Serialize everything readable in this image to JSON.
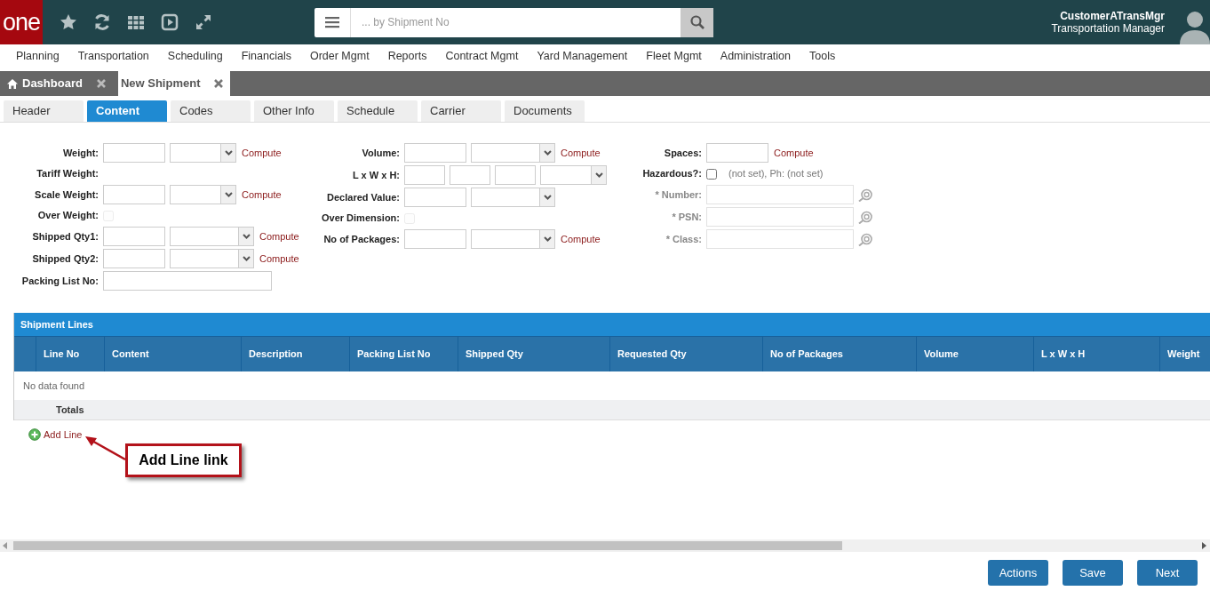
{
  "header": {
    "logo": "one",
    "search": {
      "placeholder": "... by Shipment No"
    },
    "user": {
      "name": "CustomerATransMgr",
      "role": "Transportation Manager"
    }
  },
  "menu": [
    "Planning",
    "Transportation",
    "Scheduling",
    "Financials",
    "Order Mgmt",
    "Reports",
    "Contract Mgmt",
    "Yard Management",
    "Fleet Mgmt",
    "Administration",
    "Tools"
  ],
  "page_tabs": [
    {
      "label": "Dashboard",
      "kind": "home",
      "selected": false
    },
    {
      "label": "New Shipment",
      "kind": "plain",
      "selected": true
    }
  ],
  "tabs": [
    {
      "label": "Header",
      "selected": false
    },
    {
      "label": "Content",
      "selected": true
    },
    {
      "label": "Codes",
      "selected": false
    },
    {
      "label": "Other Info",
      "selected": false
    },
    {
      "label": "Schedule",
      "selected": false
    },
    {
      "label": "Carrier",
      "selected": false
    },
    {
      "label": "Documents",
      "selected": false
    }
  ],
  "form": {
    "columns": [
      [
        {
          "kind": "measure",
          "label": "Weight:",
          "compute": "Compute"
        },
        {
          "kind": "text",
          "label": "Tariff Weight:"
        },
        {
          "kind": "measure",
          "label": "Scale Weight:",
          "compute": "Compute"
        },
        {
          "kind": "checkbox",
          "label": "Over Weight:",
          "checked": false,
          "disabled": true
        },
        {
          "kind": "quantity",
          "label": "Shipped Qty1:",
          "compute": "Compute"
        },
        {
          "kind": "quantity",
          "label": "Shipped Qty2:",
          "compute": "Compute"
        },
        {
          "kind": "wide",
          "label": "Packing List No:"
        }
      ],
      [
        {
          "kind": "quantity",
          "label": "Volume:",
          "compute": "Compute"
        },
        {
          "kind": "dims",
          "label": "L x W x H:"
        },
        {
          "kind": "quantity",
          "label": "Declared Value:"
        },
        {
          "kind": "checkbox",
          "label": "Over Dimension:",
          "checked": false,
          "disabled": true
        },
        {
          "kind": "quantity",
          "label": "No of Packages:",
          "compute": "Compute"
        }
      ],
      [
        {
          "kind": "single",
          "label": "Spaces:",
          "compute": "Compute"
        },
        {
          "kind": "checkbox",
          "label": "Hazardous?:",
          "checked": false,
          "disabled": false,
          "note": "(not set), Ph: (not set)"
        },
        {
          "kind": "lookup",
          "label": "* Number:",
          "disabled": true
        },
        {
          "kind": "lookup",
          "label": "* PSN:",
          "disabled": true
        },
        {
          "kind": "lookup",
          "label": "* Class:",
          "disabled": true
        }
      ]
    ]
  },
  "table": {
    "title": "Shipment Lines",
    "columns": [
      "Line No",
      "Content",
      "Description",
      "Packing List No",
      "Shipped Qty",
      "Requested Qty",
      "No of Packages",
      "Volume",
      "L x W x H",
      "Weight"
    ],
    "empty_message": "No data found",
    "totals_label": "Totals"
  },
  "add_line": "Add Line",
  "annotation": {
    "text": "Add Line link"
  },
  "buttons": [
    "Actions",
    "Save",
    "Next"
  ]
}
